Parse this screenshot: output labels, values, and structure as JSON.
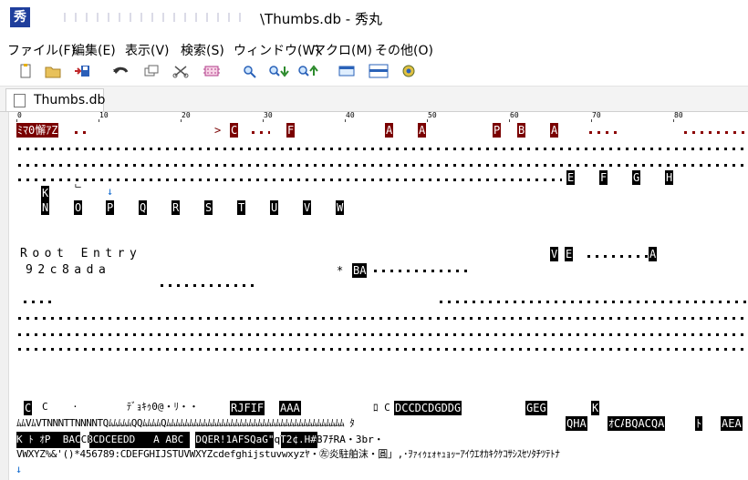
{
  "titlebar": {
    "title": "\\Thumbs.db  - 秀丸",
    "app_icon": "秀"
  },
  "menu": [
    "ファイル(F)",
    "編集(E)",
    "表示(V)",
    "検索(S)",
    "ウィンドウ(W)",
    "マクロ(M)",
    "その他(O)"
  ],
  "toolbar": [
    "new-file-icon",
    "open-folder-icon",
    "save-icon",
    "undo-icon",
    "copy-icon",
    "cut-icon",
    "paste-icon",
    "search-icon",
    "search-down-icon",
    "search-up-icon",
    "window-icon",
    "split-icon",
    "macro-icon"
  ],
  "tab": {
    "label": "Thumbs.db"
  },
  "ruler": {
    "labels": [
      "0",
      "10",
      "20",
      "30",
      "40",
      "50",
      "60",
      "70",
      "80"
    ]
  },
  "editor": {
    "line1_red": [
      "ﾐﾏ0懈ｱZ",
      "C",
      "F",
      "A",
      "A",
      "P",
      "B",
      "A"
    ],
    "line1_arrow": ">",
    "line4_cells": [
      "E",
      "F",
      "G",
      "H"
    ],
    "line5_cells": [
      "K",
      "ᄂ",
      "↓"
    ],
    "line6_cells": [
      "N",
      "O",
      "P",
      "Q",
      "R",
      "S",
      "T",
      "U",
      "V",
      "W"
    ],
    "root_entry": "Root Entry",
    "root_cells": [
      "V",
      "E",
      "A"
    ],
    "hash_line": "92c8ada",
    "asterisk": "*",
    "ba": "BA",
    "bin1_plain": "C    ·        ﾃﾞｮｷｩ0@・ﾘ・・",
    "bin1_inv": [
      "C",
      "RJFIF",
      "AAA",
      "DCCDCDGDDG",
      "GEG",
      "K"
    ],
    "bin1_mid": "ﾛ C",
    "bin2_text": "ﾑﾑVﾑVTNNNTTNNNNTQﾑﾑﾑﾑﾑQQﾑﾑﾑﾑQﾑﾑﾑﾑﾑﾑﾑﾑﾑﾑﾑﾑﾑﾑﾑﾑﾑﾑﾑﾑﾑﾑﾑﾑﾑﾑﾑﾑﾑﾑﾑﾑﾑﾑﾑﾑﾑﾑﾑ ﾀ",
    "bin2_inv": [
      "QHA",
      "ｵCA\"",
      "BQACQA",
      "ﾄ",
      "AEA"
    ],
    "bin3_text": "K ﾄ ｵP  BACCBCDCEEDD   A ABC  DQER!1AFSQaG\"qT2¢.H#B7ﾁRA・3br・",
    "bin4_text": "VWXYZ%&'()*456789:CDEFGHIJSTUVWXYZcdefghijstuvwxyzﾔ・㊧炎駐舶沫・圓」,･ｦｧｨｩｪｫｬｭｮｯｰｱｲｳｴｵｶｷｸｹｺｻｼｽｾｿﾀﾁﾂﾃﾄﾅ",
    "down_arrow": "↓"
  }
}
